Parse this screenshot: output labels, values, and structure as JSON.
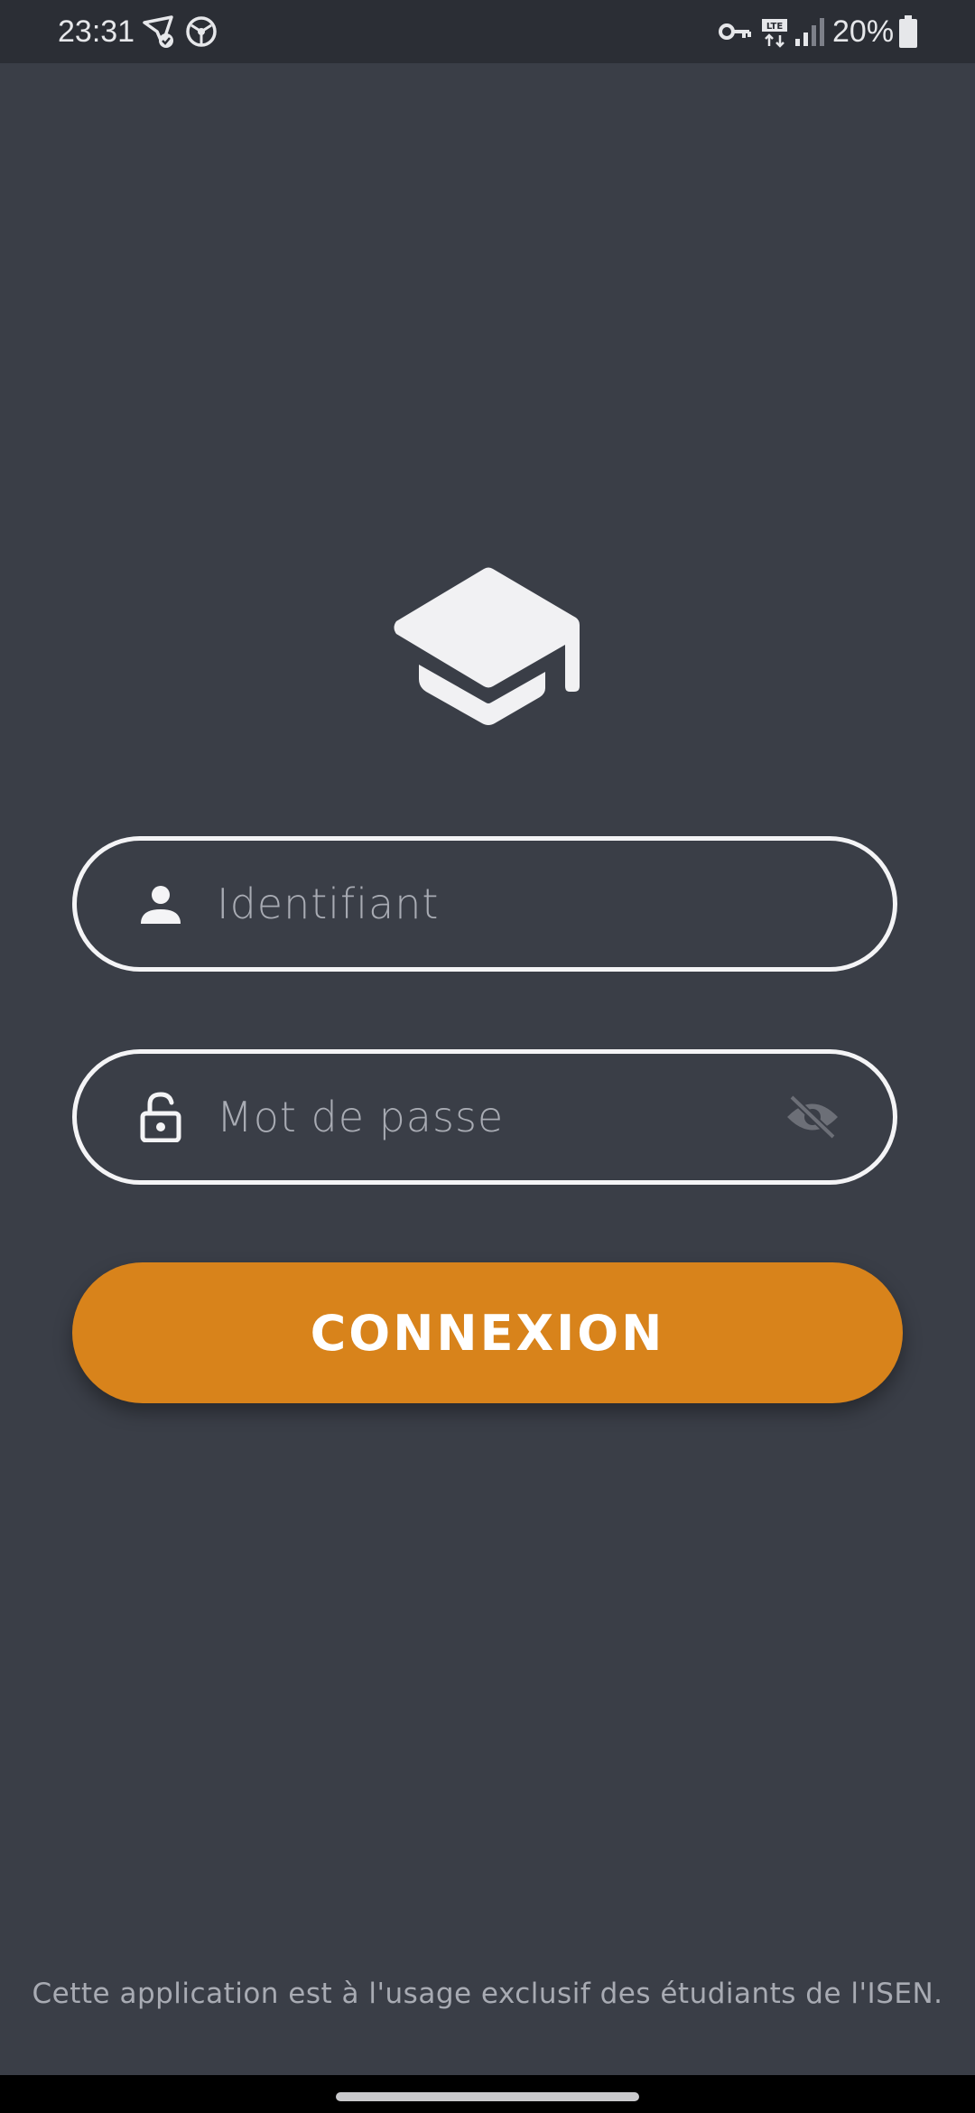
{
  "status_bar": {
    "time": "23:31",
    "battery": "20%",
    "icons": [
      "location-check-icon",
      "vpn-network-icon",
      "key-icon",
      "lte-icon",
      "signal-icon",
      "battery-icon"
    ]
  },
  "logo": {
    "icon": "graduation-cap-icon"
  },
  "login_form": {
    "username_placeholder": "Identifiant",
    "password_placeholder": "Mot de passe",
    "submit_label": "CONNEXION"
  },
  "footer": {
    "text": "Cette application est à l'usage exclusif des étudiants de l'ISEN."
  },
  "colors": {
    "background": "#3a3e47",
    "status_bar": "#2b2e35",
    "accent": "#d8831b",
    "field_border": "#f4f4f6",
    "placeholder": "#a8abb3"
  }
}
